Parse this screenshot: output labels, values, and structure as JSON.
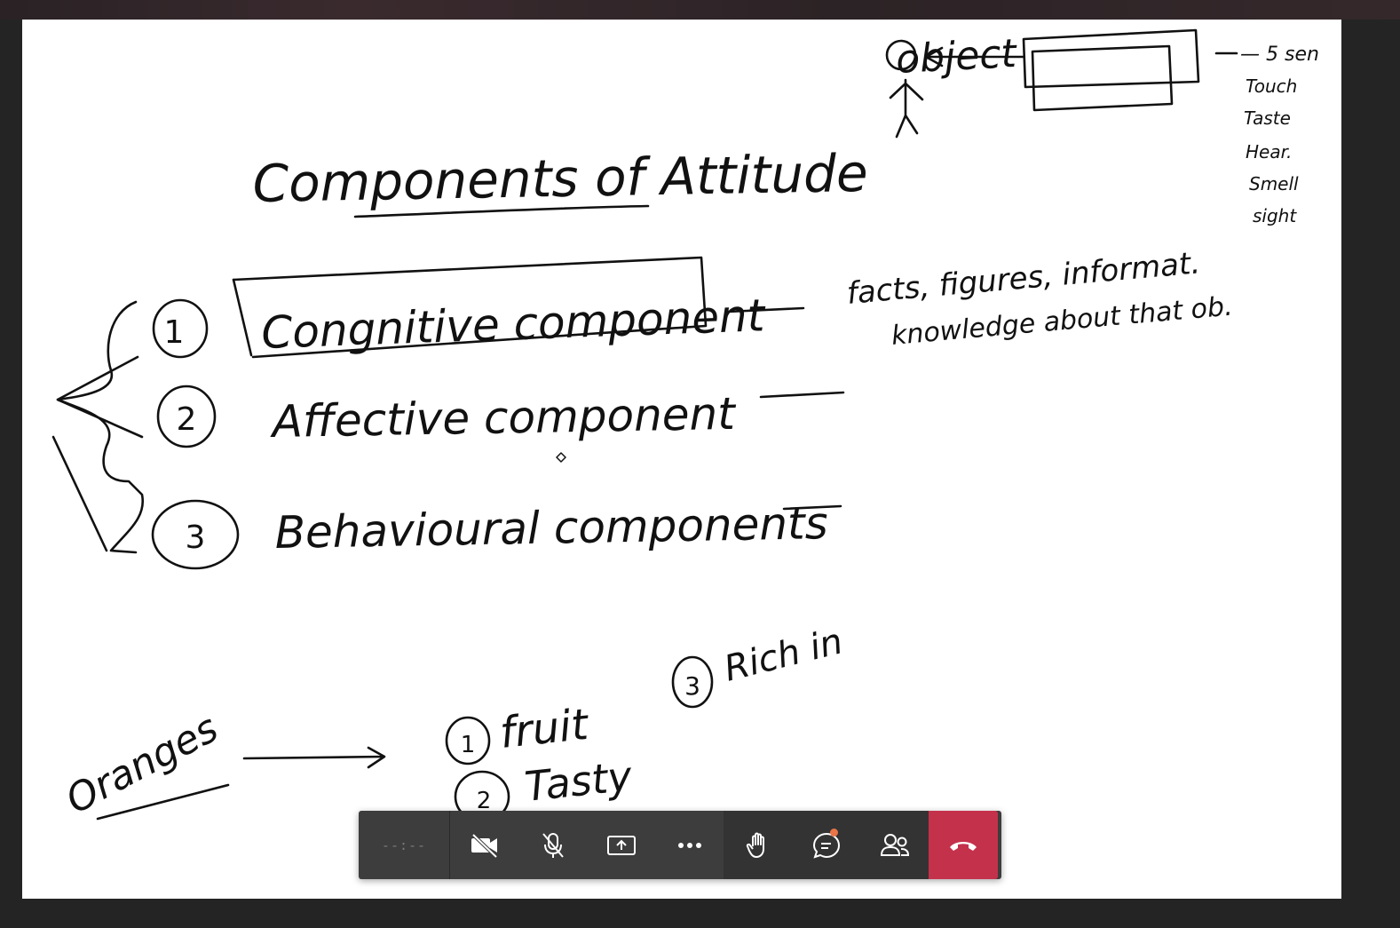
{
  "whiteboard": {
    "title": "Components of Attitude",
    "items": [
      {
        "number": "1",
        "label": "Congnitive component",
        "note": "—"
      },
      {
        "number": "2",
        "label": "Affective component",
        "note": "—"
      },
      {
        "number": "3",
        "label": "Behavioural components",
        "note": "—"
      }
    ],
    "cognitive_notes": {
      "line1": "facts, figures, informat.",
      "line2": "knowledge about that ob."
    },
    "object_label": "object",
    "senses": {
      "header": "— 5 sen",
      "list": [
        "Touch",
        "Taste",
        "Hear.",
        "Smell",
        "sight"
      ]
    },
    "example": {
      "subject": "Oranges",
      "points": [
        {
          "number": "1",
          "text": "fruit"
        },
        {
          "number": "2",
          "text": "Tasty"
        },
        {
          "number": "3",
          "text": "Rich in"
        }
      ]
    }
  },
  "toolbar": {
    "timer": "--:--",
    "buttons": [
      {
        "name": "camera-off",
        "icon": "camera-off-icon"
      },
      {
        "name": "mic-off",
        "icon": "mic-off-icon"
      },
      {
        "name": "share",
        "icon": "share-screen-icon"
      },
      {
        "name": "more",
        "icon": "more-icon"
      },
      {
        "name": "raise-hand",
        "icon": "hand-icon"
      },
      {
        "name": "chat",
        "icon": "chat-icon"
      },
      {
        "name": "participants",
        "icon": "people-icon"
      },
      {
        "name": "hang-up",
        "icon": "phone-hangup-icon"
      }
    ],
    "colors": {
      "bar": "#3d3d3d",
      "hangup": "#c4314b",
      "badge": "#e97548",
      "icon": "#ffffff"
    }
  }
}
